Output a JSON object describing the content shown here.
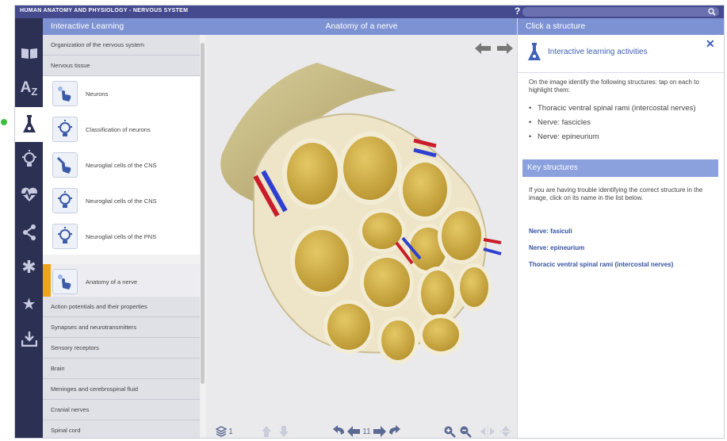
{
  "app": {
    "title": "HUMAN ANATOMY AND PHYSIOLOGY - NERVOUS SYSTEM",
    "help_label": "?"
  },
  "left": {
    "header": "Interactive Learning",
    "menu_top": [
      "Organization of the nervous system",
      "Nervous tissue"
    ],
    "sub_items": [
      {
        "label": "Neurons",
        "icon": "hand-pointer-icon",
        "active": false
      },
      {
        "label": "Classification of neurons",
        "icon": "lightbulb-icon",
        "active": false
      },
      {
        "label": "Neuroglial cells of the CNS",
        "icon": "dropper-hand-icon",
        "active": false
      },
      {
        "label": "Neuroglial cells of the CNS",
        "icon": "lightbulb-icon",
        "active": false
      },
      {
        "label": "Neuroglial cells of the PNS",
        "icon": "lightbulb-icon",
        "active": false
      },
      {
        "label": "Anatomy of a nerve",
        "icon": "hand-pointer-icon",
        "active": true
      }
    ],
    "menu_bottom": [
      "Action potentials and their properties",
      "Synapses and neurotransmitters",
      "Sensory receptors",
      "Brain",
      "Meninges and cerebrospinal fluid",
      "Cranial nerves",
      "Spinal cord"
    ]
  },
  "center": {
    "header": "Anatomy of a nerve",
    "layer_count": "1",
    "page_number": "11"
  },
  "right": {
    "header": "Click a structure",
    "title": "Interactive learning activities",
    "instructions": "On the image identify the following structures: tap on each to highlight them:",
    "bullets": [
      "Thoracic ventral spinal rami (intercostal nerves)",
      "Nerve: fascicles",
      "Nerve: epineurium"
    ],
    "key_header": "Key structures",
    "key_instructions": "If you are having trouble identifying the correct structure in the image, click on its name in the list below.",
    "key_links": [
      "Nerve: fasiculi",
      "Nerve: epineurium",
      "Thoracic ventral spinal rami (intercostal nerves)"
    ]
  },
  "colors": {
    "title_bar": "#454a8f",
    "header_blue": "#7d92d3",
    "rail": "#2c3153",
    "active_marker": "#f0a21b",
    "fascicle": "#d4b44c"
  }
}
